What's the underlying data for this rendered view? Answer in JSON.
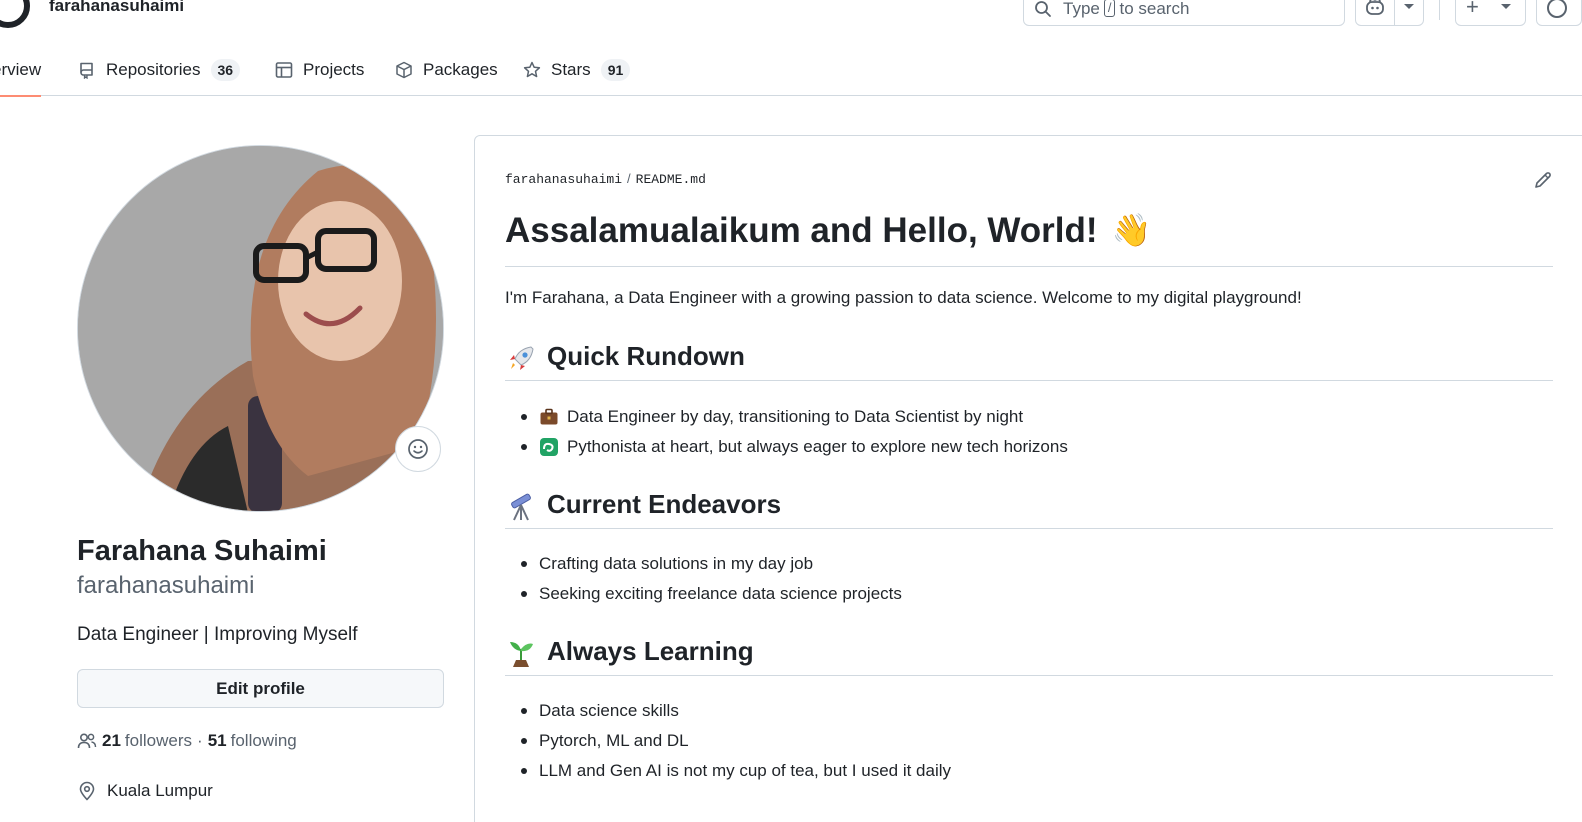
{
  "header": {
    "username": "farahanasuhaimi",
    "search": {
      "prefix": "Type",
      "key": "/",
      "suffix": "to search"
    }
  },
  "tabs": [
    {
      "label": "erview"
    },
    {
      "label": "Repositories",
      "count": "36"
    },
    {
      "label": "Projects"
    },
    {
      "label": "Packages"
    },
    {
      "label": "Stars",
      "count": "91"
    }
  ],
  "profile": {
    "full_name": "Farahana Suhaimi",
    "login": "farahanasuhaimi",
    "bio": "Data Engineer | Improving Myself",
    "edit_label": "Edit profile",
    "followers_count": "21",
    "followers_label": "followers",
    "separator": "·",
    "following_count": "51",
    "following_label": "following",
    "location": "Kuala Lumpur"
  },
  "readme": {
    "crumb_owner": "farahanasuhaimi",
    "crumb_sep": "/",
    "crumb_file": "README.md",
    "title": "Assalamualaikum and Hello, World!",
    "title_emoji": "👋",
    "intro": "I'm Farahana, a Data Engineer with a growing passion to data science. Welcome to my digital playground!",
    "sections": [
      {
        "heading": "Quick Rundown",
        "icon": "rocket-icon",
        "items": [
          {
            "text": "Data Engineer by day, transitioning to Data Scientist by night",
            "icon": "briefcase-icon"
          },
          {
            "text": "Pythonista at heart, but always eager to explore new tech horizons",
            "icon": "loop-icon"
          }
        ]
      },
      {
        "heading": "Current Endeavors",
        "icon": "telescope-icon",
        "items": [
          {
            "text": "Crafting data solutions in my day job"
          },
          {
            "text": "Seeking exciting freelance data science projects"
          }
        ]
      },
      {
        "heading": "Always Learning",
        "icon": "seedling-icon",
        "items": [
          {
            "text": "Data science skills"
          },
          {
            "text": "Pytorch, ML and DL"
          },
          {
            "text": "LLM and Gen AI is not my cup of tea, but I used it daily"
          }
        ]
      }
    ]
  },
  "colors": {
    "accent_underline": "#fd8c73",
    "text": "#1f2328",
    "muted": "#59636e",
    "border": "#d1d9e0"
  }
}
